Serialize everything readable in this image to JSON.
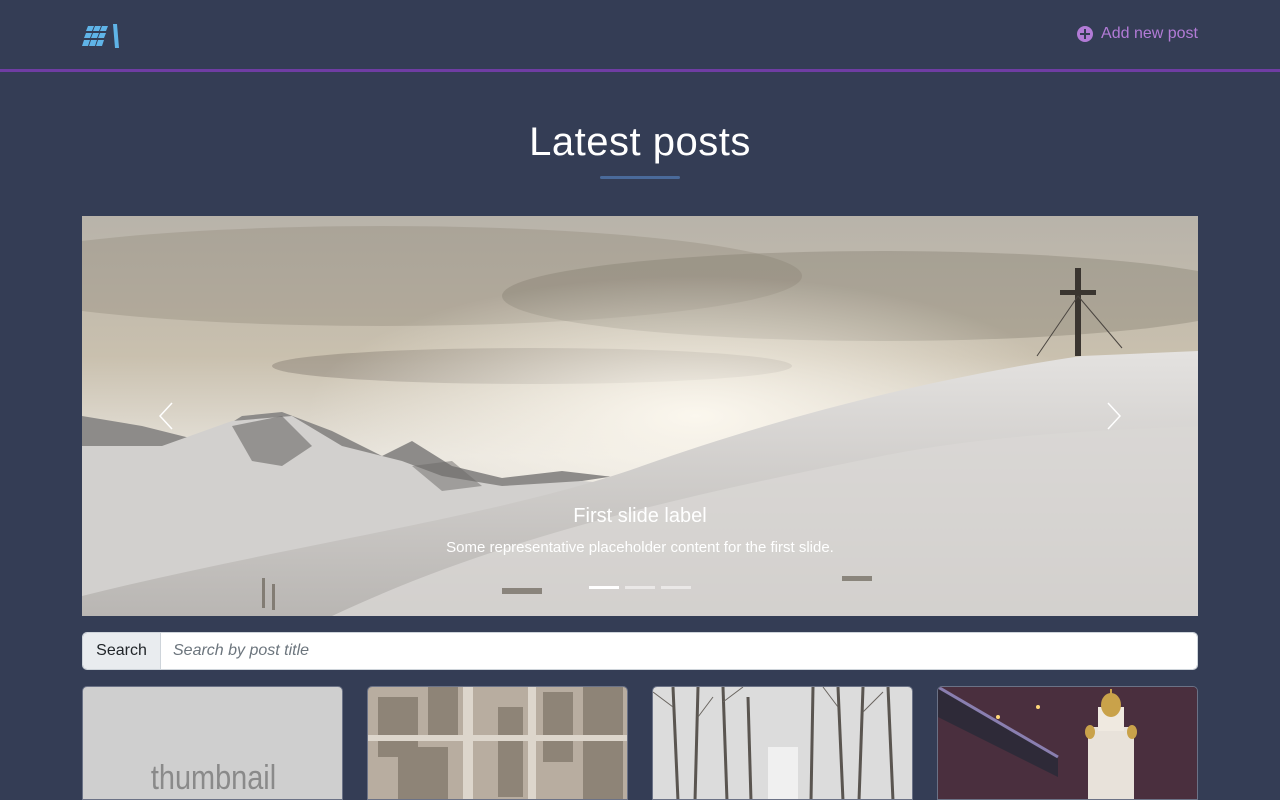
{
  "header": {
    "logo_icon": "brand-logo-icon",
    "add_post_label": "Add new post",
    "add_post_icon": "plus-circle-icon",
    "accent_color": "#b27bd6"
  },
  "main": {
    "title": "Latest posts"
  },
  "carousel": {
    "slide_title": "First slide label",
    "slide_text": "Some representative placeholder content for the first slide.",
    "slides_count": 3,
    "active_slide": 1,
    "prev_icon": "chevron-left-icon",
    "next_icon": "chevron-right-icon"
  },
  "search": {
    "label": "Search",
    "placeholder": "Search by post title",
    "value": ""
  },
  "posts": [
    {
      "thumbnail_text": "thumbnail"
    },
    {
      "thumbnail_text": ""
    },
    {
      "thumbnail_text": ""
    },
    {
      "thumbnail_text": ""
    }
  ]
}
